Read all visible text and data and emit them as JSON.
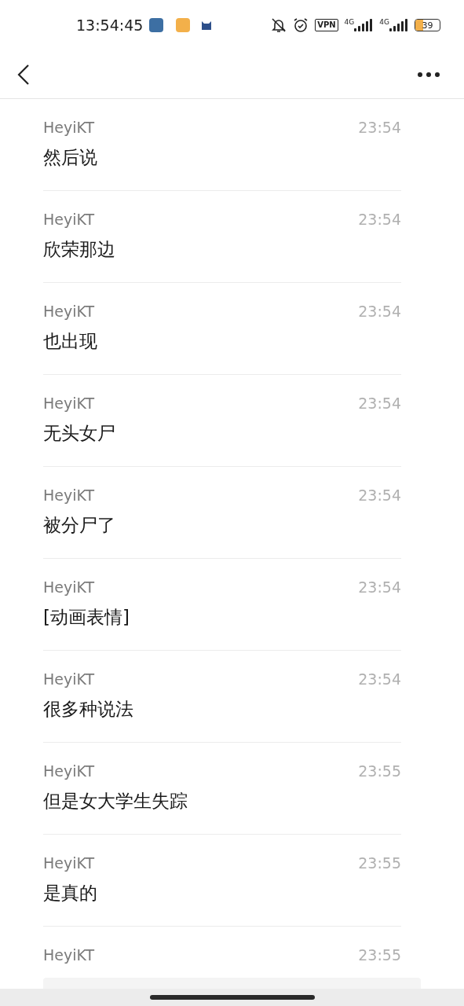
{
  "status_bar": {
    "time": "13:54:45",
    "vpn": "VPN",
    "network_1": "4G",
    "network_2": "4G",
    "battery": "39"
  },
  "messages": [
    {
      "kind": "text",
      "sender": "HeyiKT",
      "time": "23:54",
      "text": "然后说"
    },
    {
      "kind": "text",
      "sender": "HeyiKT",
      "time": "23:54",
      "text": "欣荣那边"
    },
    {
      "kind": "text",
      "sender": "HeyiKT",
      "time": "23:54",
      "text": "也出现"
    },
    {
      "kind": "text",
      "sender": "HeyiKT",
      "time": "23:54",
      "text": "无头女尸"
    },
    {
      "kind": "text",
      "sender": "HeyiKT",
      "time": "23:54",
      "text": "被分尸了"
    },
    {
      "kind": "text",
      "sender": "HeyiKT",
      "time": "23:54",
      "text": "[动画表情]"
    },
    {
      "kind": "text",
      "sender": "HeyiKT",
      "time": "23:54",
      "text": "很多种说法"
    },
    {
      "kind": "text",
      "sender": "HeyiKT",
      "time": "23:55",
      "text": "但是女大学生失踪"
    },
    {
      "kind": "text",
      "sender": "HeyiKT",
      "time": "23:55",
      "text": "是真的"
    },
    {
      "kind": "card",
      "sender": "HeyiKT",
      "time": "23:55"
    }
  ]
}
